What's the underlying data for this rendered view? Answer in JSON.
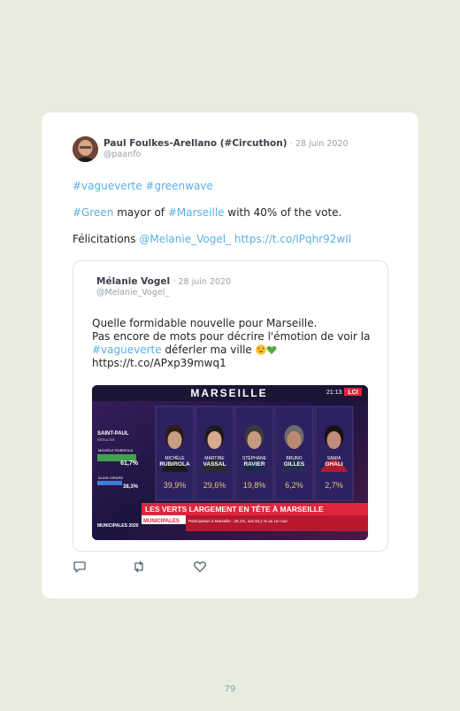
{
  "tweet": {
    "author_name": "Paul Foulkes-Arellano (#Circuthon)",
    "date": "· 28 juin 2020",
    "handle": "@paanfo",
    "line1": "#vagueverte #greenwave",
    "line2_tag1": "#Green",
    "line2_text1": " mayor of ",
    "line2_tag2": "#Marseille",
    "line2_text2": " with 40% of the vote.",
    "line3_text": "Félicitations ",
    "line3_mention": "@Melanie_Vogel_",
    "line3_link": " https://t.co/lPqhr92wIl"
  },
  "quote": {
    "author_name": "Mélanie Vogel",
    "date": "· 28 juin 2020",
    "handle": "@Melanie_Vogel_",
    "line1": "Quelle formidable nouvelle pour Marseille.",
    "line2": "Pas encore de mots pour décrire l'émotion de voir la",
    "line3_tag": "#vagueverte",
    "line3_text": " déferler ma ville ",
    "line4_link": "https://t.co/APxp39mwq1"
  },
  "media": {
    "city": "MARSEILLE",
    "clock": "21:13",
    "channel": "LCI",
    "side_title": "SAINT-PAUL",
    "side_sub": "RÉSULTAT",
    "side_c1": "MICHÈLE RUBIROLA",
    "side_c1_pct": "61,7%",
    "side_c2": "ALAIN GIRARD",
    "side_c2_pct": "38,3%",
    "candidates": [
      {
        "name1": "MICHÈLE",
        "name2": "RUBIROLA",
        "pct": "39,9%"
      },
      {
        "name1": "MARTINE",
        "name2": "VASSAL",
        "pct": "29,6%"
      },
      {
        "name1": "STÉPHANE",
        "name2": "RAVIER",
        "pct": "19,8%"
      },
      {
        "name1": "BRUNO",
        "name2": "GILLES",
        "pct": "6,2%"
      },
      {
        "name1": "SAMIA",
        "name2": "GHALI",
        "pct": "2,7%"
      }
    ],
    "headline": "LES VERTS LARGEMENT EN TÊTE À MARSEILLE",
    "tag": "MUNICIPALES",
    "ticker": "Participation à Marseille : 28,1%, soit 33,2 % au 1er tour",
    "logo": "MUNICIPALES 2020"
  },
  "icons": {
    "reply": "reply-icon",
    "retweet": "retweet-icon",
    "like": "like-icon"
  },
  "colors": {
    "link": "#5ab0e4",
    "background": "#e8ecdf",
    "banner": "#e0263d"
  },
  "page_number": "79"
}
